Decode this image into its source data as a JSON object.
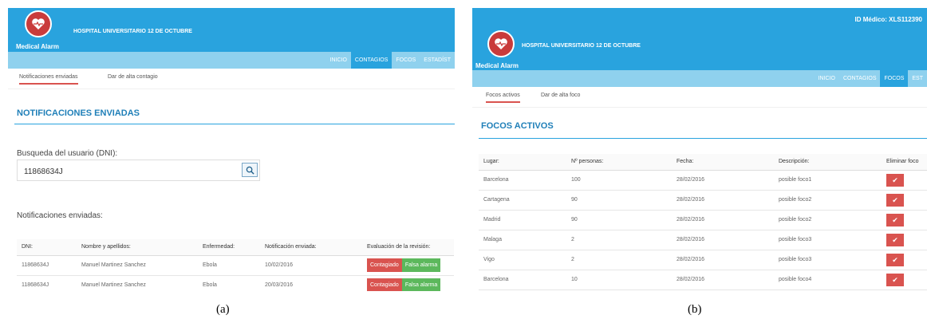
{
  "panel_a": {
    "app_name": "Medical Alarm",
    "hospital": "HOSPITAL UNIVERSITARIO 12 DE OCTUBRE",
    "logo_icon": "heart-icon",
    "nav": [
      "INICIO",
      "CONTAGIOS",
      "FOCOS",
      "ESTADÍST"
    ],
    "nav_active": "CONTAGIOS",
    "subtabs": [
      "Notificaciones enviadas",
      "Dar de alta contagio"
    ],
    "section_title": "NOTIFICACIONES ENVIADAS",
    "search_label": "Busqueda del usuario (DNI):",
    "search_value": "11868634J",
    "list_label": "Notificaciones enviadas:",
    "table_headers": [
      "DNI:",
      "Nombre y apellidos:",
      "Enfermedad:",
      "Notificación enviada:",
      "Evaluación de la revisión:"
    ],
    "rows": [
      {
        "dni": "11868634J",
        "nombre": "Manuel Martinez Sanchez",
        "enfermedad": "Ebola",
        "fecha": "10/02/2016",
        "btn1": "Contagiado",
        "btn2": "Falsa alarma"
      },
      {
        "dni": "11868634J",
        "nombre": "Manuel Martinez Sanchez",
        "enfermedad": "Ebola",
        "fecha": "20/03/2016",
        "btn1": "Contagiado",
        "btn2": "Falsa alarma"
      }
    ],
    "caption": "(a)"
  },
  "panel_b": {
    "id_medico": "ID Médico: XLS112390",
    "app_name": "Medical Alarm",
    "hospital": "HOSPITAL UNIVERSITARIO 12 DE OCTUBRE",
    "logo_icon": "heart-icon",
    "nav": [
      "INICIO",
      "CONTAGIOS",
      "FOCOS",
      "EST"
    ],
    "nav_active": "FOCOS",
    "subtabs": [
      "Focos activos",
      "Dar de alta foco"
    ],
    "section_title": "FOCOS ACTIVOS",
    "table_headers": [
      "Lugar:",
      "Nº personas:",
      "Fecha:",
      "Descripción:",
      "Eliminar foco"
    ],
    "rows": [
      {
        "lugar": "Barcelona",
        "personas": "100",
        "fecha": "28/02/2016",
        "desc": "posible foco1"
      },
      {
        "lugar": "Cartagena",
        "personas": "90",
        "fecha": "28/02/2016",
        "desc": "posible foco2"
      },
      {
        "lugar": "Madrid",
        "personas": "90",
        "fecha": "28/02/2016",
        "desc": "posible foco2"
      },
      {
        "lugar": "Malaga",
        "personas": "2",
        "fecha": "28/02/2016",
        "desc": "posible foco3"
      },
      {
        "lugar": "Vigo",
        "personas": "2",
        "fecha": "28/02/2016",
        "desc": "posible foco3"
      },
      {
        "lugar": "Barcelona",
        "personas": "10",
        "fecha": "28/02/2016",
        "desc": "posible foco4"
      }
    ],
    "delete_icon": "check-icon",
    "caption": "(b)"
  },
  "colors": {
    "header": "#29a3de",
    "nav": "#8fd1ee",
    "danger": "#d9534f",
    "success": "#5cb85c",
    "title": "#1f7fb8"
  }
}
